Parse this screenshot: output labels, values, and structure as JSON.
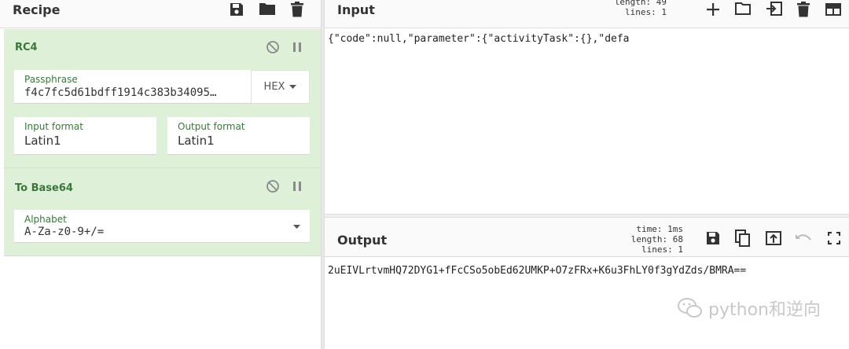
{
  "recipe": {
    "title": "Recipe",
    "icons": [
      "save-icon",
      "folder-icon",
      "trash-icon"
    ],
    "operations": [
      {
        "name": "RC4",
        "passphrase_label": "Passphrase",
        "passphrase_value": "f4c7fc5d61bdff1914c383b34095…",
        "passphrase_format": "HEX",
        "input_format_label": "Input format",
        "input_format_value": "Latin1",
        "output_format_label": "Output format",
        "output_format_value": "Latin1"
      },
      {
        "name": "To Base64",
        "alphabet_label": "Alphabet",
        "alphabet_value": "A-Za-z0-9+/="
      }
    ]
  },
  "input": {
    "title": "Input",
    "stats_length_label": "length:",
    "stats_length_value": "49",
    "stats_lines_label": "lines:",
    "stats_lines_value": "1",
    "content": "{\"code\":null,\"parameter\":{\"activityTask\":{},\"defa"
  },
  "output": {
    "title": "Output",
    "stats_time_label": "time:",
    "stats_time_value": "1ms",
    "stats_length_label": "length:",
    "stats_length_value": "68",
    "stats_lines_label": "lines:",
    "stats_lines_value": "1",
    "content": "2uEIVLrtvmHQ72DYG1+fFcCSo5obEd62UMKP+O7zFRx+K6u3FhLY0f3gYdZds/BMRA=="
  },
  "watermark": {
    "text": "python和逆向"
  }
}
